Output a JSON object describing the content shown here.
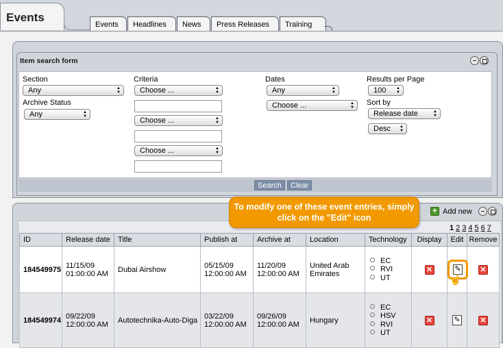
{
  "app": {
    "main_tab": "Events",
    "tabs": [
      "Events",
      "Headlines",
      "News",
      "Press Releases",
      "Training"
    ]
  },
  "search_form": {
    "title": "Item search form",
    "section": {
      "label": "Section",
      "value": "Any"
    },
    "archive_status": {
      "label": "Archive Status",
      "value": "Any"
    },
    "criteria": {
      "label": "Criteria",
      "selects": [
        "Choose ...",
        "Choose ...",
        "Choose ..."
      ],
      "inputs": [
        "",
        "",
        ""
      ]
    },
    "dates": {
      "label": "Dates",
      "value": "Any",
      "second": "Choose ..."
    },
    "results_per_page": {
      "label": "Results per Page",
      "value": "100"
    },
    "sort_by": {
      "label": "Sort by",
      "value": "Release date",
      "order": "Desc"
    },
    "buttons": {
      "search": "Search",
      "clear": "Clear"
    }
  },
  "results": {
    "tooltip": "To modify one of these event entries, simply click on the \"Edit\" icon",
    "add_new": "Add new",
    "pages": [
      "1",
      "2",
      "3",
      "4",
      "5",
      "6",
      "7"
    ],
    "current_page": "1",
    "columns": [
      "ID",
      "Release date",
      "Title",
      "Publish at",
      "Archive at",
      "Location",
      "Technology",
      "Display",
      "Edit",
      "Remove"
    ],
    "rows": [
      {
        "id": "184549975",
        "release_date": "11/15/09",
        "release_time": "01:00:00 AM",
        "title": "Dubai Airshow",
        "publish_date": "05/15/09",
        "publish_time": "12:00:00 AM",
        "archive_date": "11/20/09",
        "archive_time": "12:00:00 AM",
        "location": "United Arab Emirates",
        "technology": [
          "EC",
          "RVI",
          "UT"
        ]
      },
      {
        "id": "184549974",
        "release_date": "09/22/09",
        "release_time": "12:00:00 AM",
        "title": "Autotechnika-Auto-Diga",
        "publish_date": "03/22/09",
        "publish_time": "12:00:00 AM",
        "archive_date": "09/26/09",
        "archive_time": "12:00:00 AM",
        "location": "Hungary",
        "technology": [
          "EC",
          "HSV",
          "RVI",
          "UT"
        ]
      }
    ]
  },
  "icons": {
    "add_new": "add-icon",
    "display": "x-icon",
    "edit": "edit-icon",
    "remove": "x-icon",
    "highlight_color": "#f29900"
  }
}
